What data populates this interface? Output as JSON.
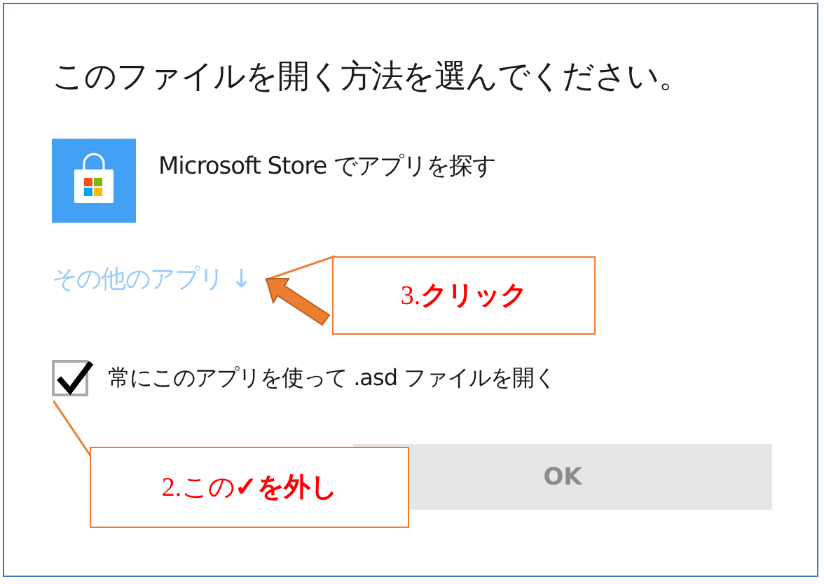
{
  "dialog": {
    "title": "このファイルを開く方法を選んでください。",
    "store_option": "Microsoft Store でアプリを探す",
    "more_apps_link": "その他のアプリ ↓",
    "always_use": {
      "label": "常にこのアプリを使って .asd ファイルを開く",
      "checked": true
    },
    "ok_button": {
      "label": "OK",
      "disabled": true
    }
  },
  "annotations": [
    {
      "text": "3.**クリック**"
    },
    {
      "text": "2.この**✓を外し**"
    }
  ]
}
